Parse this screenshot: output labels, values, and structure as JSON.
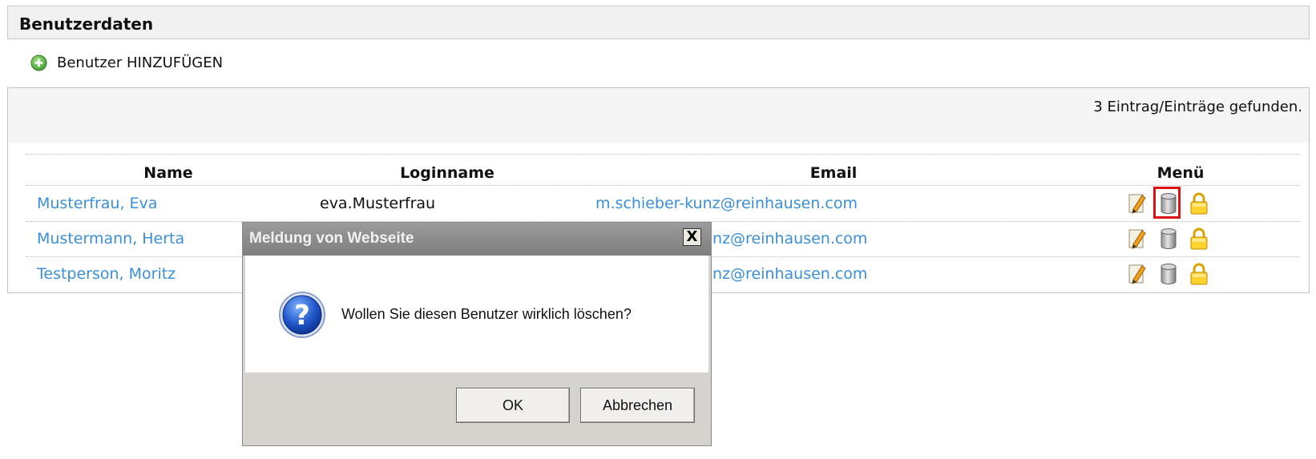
{
  "header": {
    "title": "Benutzerdaten"
  },
  "add_user": {
    "label": "Benutzer HINZUFÜGEN",
    "icon": "plus-circle-icon"
  },
  "result_count": "3 Eintrag/Einträge gefunden.",
  "table": {
    "columns": [
      "Name",
      "Loginname",
      "Email",
      "Menü"
    ],
    "rows": [
      {
        "name": "Musterfrau, Eva",
        "login": "eva.Musterfrau",
        "email": "m.schieber-kunz@reinhausen.com"
      },
      {
        "name": "Mustermann, Herta",
        "login": "",
        "email": "unz@reinhausen.com"
      },
      {
        "name": "Testperson, Moritz",
        "login": "",
        "email": "unz@reinhausen.com"
      }
    ],
    "menu_icons": [
      "edit-pencil-icon",
      "delete-database-icon",
      "lock-icon"
    ]
  },
  "dialog": {
    "title": "Meldung von Webseite",
    "close_label": "X",
    "message": "Wollen Sie diesen Benutzer wirklich löschen?",
    "ok_label": "OK",
    "cancel_label": "Abbrechen",
    "icon": "question-icon"
  },
  "colors": {
    "link": "#3a8fd8",
    "highlight": "#e01010"
  }
}
